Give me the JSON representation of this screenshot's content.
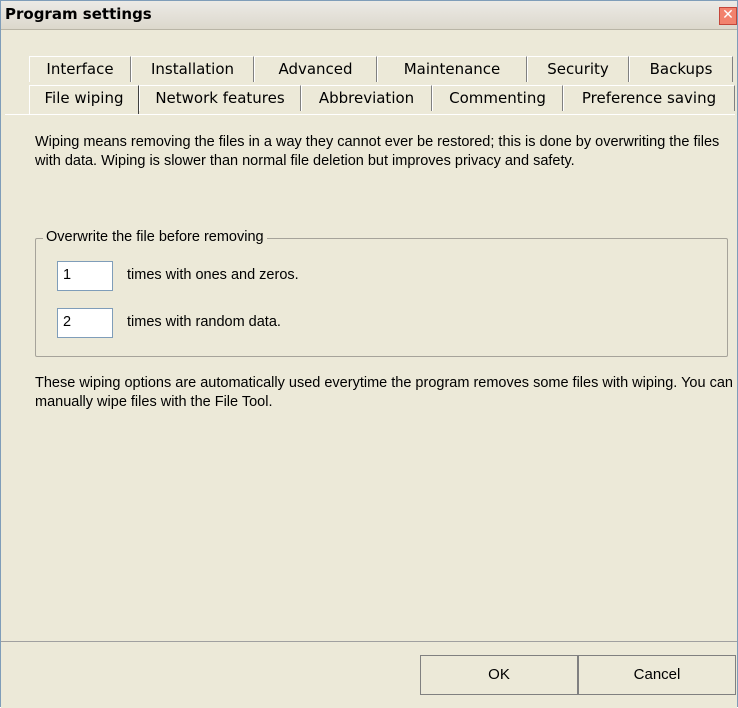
{
  "window": {
    "title": "Program settings"
  },
  "tabs_row1": [
    "Interface",
    "Installation",
    "Advanced",
    "Maintenance",
    "Security",
    "Backups"
  ],
  "tabs_row2": [
    "File wiping",
    "Network features",
    "Abbreviation",
    "Commenting",
    "Preference saving"
  ],
  "active_tab": "File wiping",
  "content": {
    "intro": "Wiping means removing the files in a way they cannot ever be restored; this is done by overwriting the files with data. Wiping is slower than normal file deletion but improves privacy and safety.",
    "group_label": "Overwrite the file before removing",
    "ones_value": "1",
    "ones_label": "times with ones and zeros.",
    "random_value": "2",
    "random_label": "times with random data.",
    "footer": "These wiping options are automatically used everytime the program removes some files with wiping. You can manually wipe files with the File Tool."
  },
  "buttons": {
    "ok": "OK",
    "cancel": "Cancel"
  }
}
